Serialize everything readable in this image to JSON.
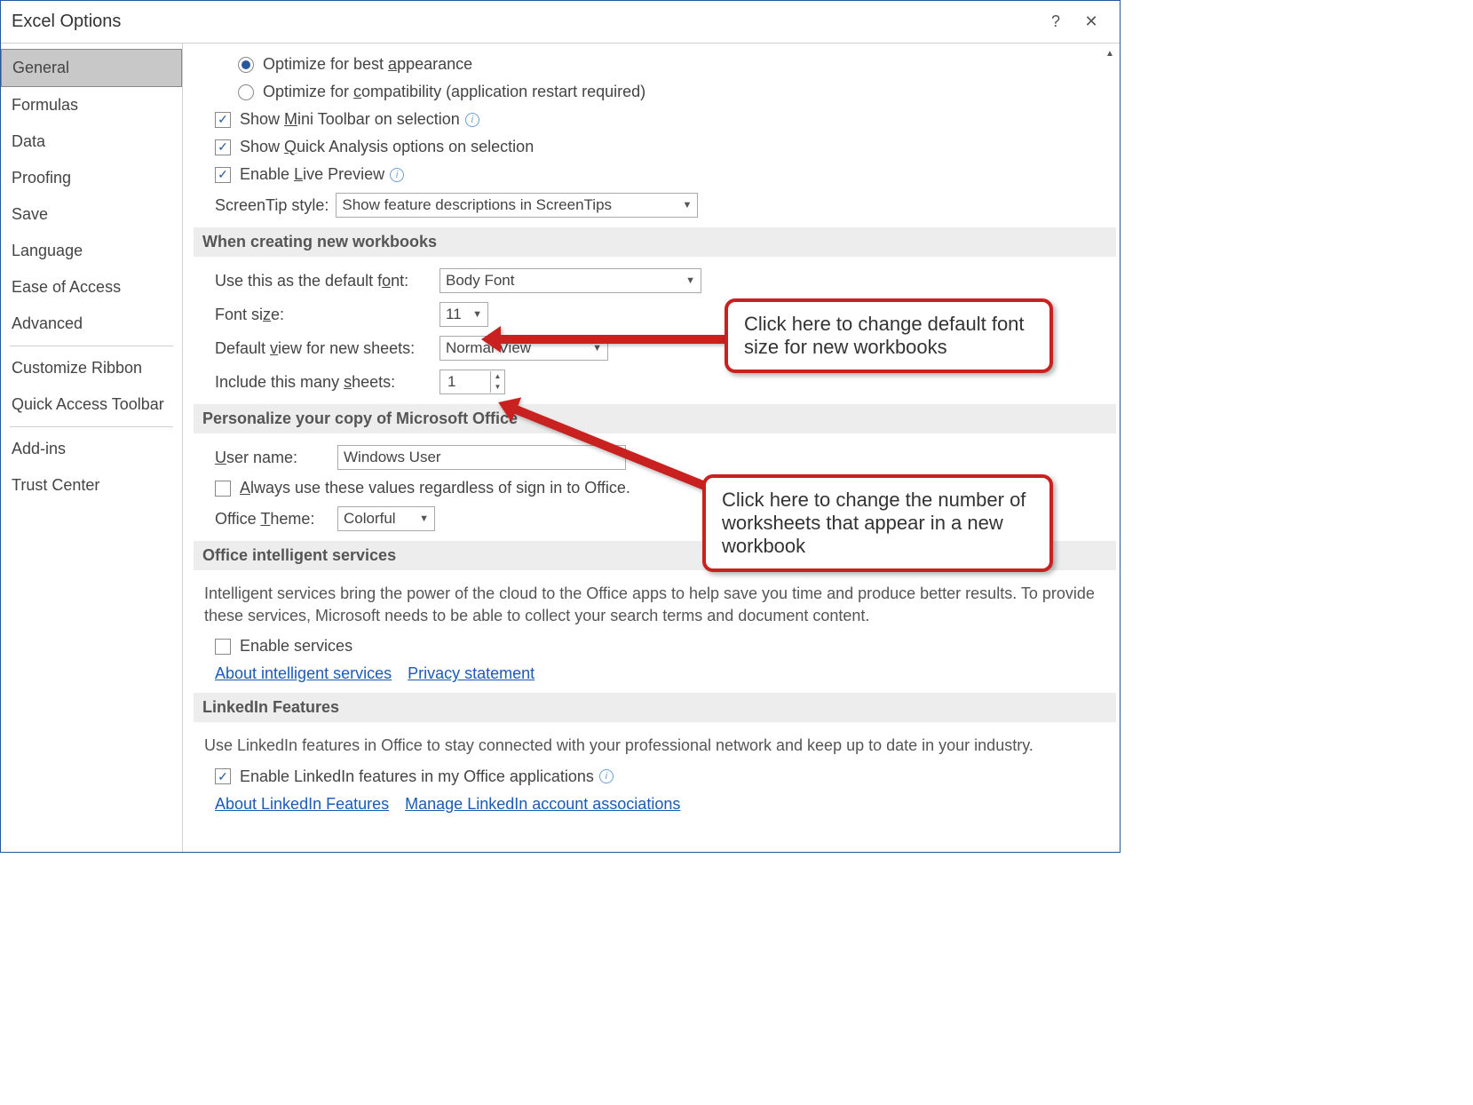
{
  "title": "Excel Options",
  "sidebar": {
    "items": [
      {
        "label": "General",
        "active": true
      },
      {
        "label": "Formulas"
      },
      {
        "label": "Data"
      },
      {
        "label": "Proofing"
      },
      {
        "label": "Save"
      },
      {
        "label": "Language"
      },
      {
        "label": "Ease of Access"
      },
      {
        "label": "Advanced"
      }
    ],
    "group2": [
      {
        "label": "Customize Ribbon"
      },
      {
        "label": "Quick Access Toolbar"
      }
    ],
    "group3": [
      {
        "label": "Add-ins"
      },
      {
        "label": "Trust Center"
      }
    ]
  },
  "ui": {
    "optimize_appearance": "Optimize for best appearance",
    "optimize_compat": "Optimize for compatibility (application restart required)",
    "mini_toolbar": "Show Mini Toolbar on selection",
    "quick_analysis": "Show Quick Analysis options on selection",
    "live_preview": "Enable Live Preview",
    "screentip_label": "ScreenTip style:",
    "screentip_value": "Show feature descriptions in ScreenTips",
    "section_new_workbooks": "When creating new workbooks",
    "default_font_label": "Use this as the default font:",
    "default_font_value": "Body Font",
    "font_size_label": "Font size:",
    "font_size_value": "11",
    "default_view_label": "Default view for new sheets:",
    "default_view_value": "Normal View",
    "sheets_label": "Include this many sheets:",
    "sheets_value": "1",
    "section_personalize": "Personalize your copy of Microsoft Office",
    "username_label": "User name:",
    "username_value": "Windows User",
    "always_values": "Always use these values regardless of sign in to Office.",
    "office_theme_label": "Office Theme:",
    "office_theme_value": "Colorful",
    "section_intelligent": "Office intelligent services",
    "intelligent_para": "Intelligent services bring the power of the cloud to the Office apps to help save you time and produce better results. To provide these services, Microsoft needs to be able to collect your search terms and document content.",
    "enable_services": "Enable services",
    "link_intel_services": "About intelligent services",
    "link_privacy": "Privacy statement",
    "section_linkedin": "LinkedIn Features",
    "linkedin_para": "Use LinkedIn features in Office to stay connected with your professional network and keep up to date in your industry.",
    "enable_linkedin": "Enable LinkedIn features in my Office applications",
    "link_linkedin_about": "About LinkedIn Features",
    "link_linkedin_manage": "Manage LinkedIn account associations"
  },
  "annotations": {
    "callout1": "Click here to change default font size for new workbooks",
    "callout2": "Click here to change the number of worksheets that appear in a new workbook"
  }
}
